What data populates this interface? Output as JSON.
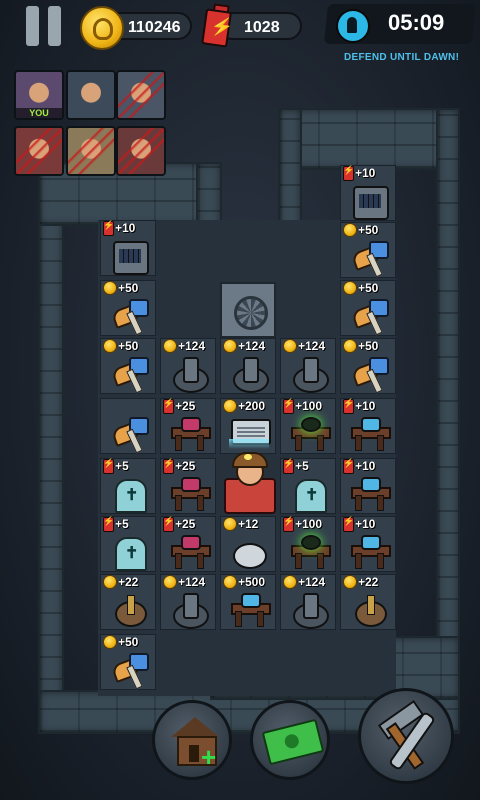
{
  "hud": {
    "coins": "110246",
    "energy": "1028",
    "timer": "05:09",
    "objective": "DEFEND UNTIL DAWN!"
  },
  "players": [
    {
      "label": "YOU",
      "eliminated": false
    },
    {
      "label": "",
      "eliminated": false
    },
    {
      "label": "",
      "eliminated": true
    },
    {
      "label": "",
      "eliminated": true
    },
    {
      "label": "",
      "eliminated": true
    },
    {
      "label": "",
      "eliminated": true
    }
  ],
  "tiles": [
    {
      "res": "energy",
      "value": "+10",
      "item": "bed"
    },
    {
      "res": "energy",
      "value": "+10",
      "item": "bed"
    },
    {
      "res": "coin",
      "value": "+50",
      "item": "axe"
    },
    {
      "res": "coin",
      "value": "+50",
      "item": "axe"
    },
    {
      "res": "coin",
      "value": "+50",
      "item": "axe"
    },
    {
      "res": "coin",
      "value": "+124",
      "item": "turret"
    },
    {
      "res": "coin",
      "value": "+124",
      "item": "turret"
    },
    {
      "res": "coin",
      "value": "+124",
      "item": "turret"
    },
    {
      "res": "coin",
      "value": "+50",
      "item": "axe"
    },
    {
      "res": "coin",
      "value": "+50",
      "item": "axe"
    },
    {
      "res": "energy",
      "value": "+25",
      "item": "table"
    },
    {
      "res": "coin",
      "value": "+200",
      "item": "ac"
    },
    {
      "res": "energy",
      "value": "+100",
      "item": "table-green"
    },
    {
      "res": "energy",
      "value": "+10",
      "item": "table-blue"
    },
    {
      "res": "energy",
      "value": "+5",
      "item": "door"
    },
    {
      "res": "energy",
      "value": "+25",
      "item": "table"
    },
    {
      "res": "energy",
      "value": "+5",
      "item": "door"
    },
    {
      "res": "energy",
      "value": "+10",
      "item": "table-blue"
    },
    {
      "res": "energy",
      "value": "+5",
      "item": "door"
    },
    {
      "res": "energy",
      "value": "+25",
      "item": "table"
    },
    {
      "res": "coin",
      "value": "+12",
      "item": "plate"
    },
    {
      "res": "energy",
      "value": "+100",
      "item": "table-green"
    },
    {
      "res": "energy",
      "value": "+10",
      "item": "table-blue"
    },
    {
      "res": "coin",
      "value": "+22",
      "item": "trap"
    },
    {
      "res": "coin",
      "value": "+124",
      "item": "turret"
    },
    {
      "res": "coin",
      "value": "+500",
      "item": "table-blue"
    },
    {
      "res": "coin",
      "value": "+124",
      "item": "turret"
    },
    {
      "res": "coin",
      "value": "+22",
      "item": "trap"
    },
    {
      "res": "coin",
      "value": "+50",
      "item": "axe"
    }
  ],
  "icons": {
    "pause": "pause-icon",
    "coin": "coin-icon",
    "energy": "battery-icon",
    "timer": "alarm-icon",
    "build": "house-plus-icon",
    "shop": "cash-icon",
    "upgrade": "hammer-wrench-icon"
  }
}
